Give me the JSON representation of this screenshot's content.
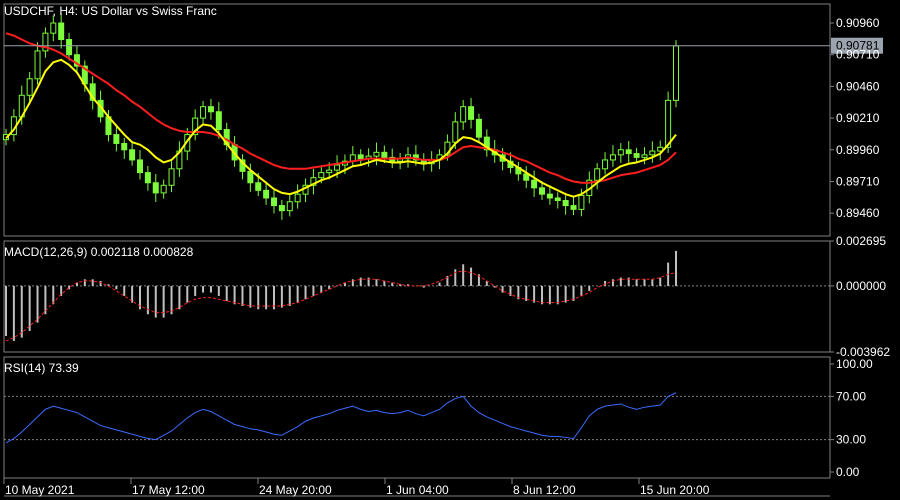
{
  "chart_data": [
    {
      "type": "candlestick",
      "title": "USDCHF, H4:  US Dollar vs Swiss Franc",
      "symbol": "USDCHF",
      "timeframe": "H4",
      "ylim": [
        0.8928,
        0.9111
      ],
      "y_ticks": [
        "0.90960",
        "0.90710",
        "0.90460",
        "0.90210",
        "0.89960",
        "0.89710",
        "0.89460"
      ],
      "current_price": "0.90781",
      "colors": {
        "bull": "#7CFC3A",
        "bear": "#7CFC3A",
        "ma_fast": "#FFFF00",
        "ma_slow": "#FF1E1E",
        "price_line": "#9BA3AE"
      },
      "closes": [
        0.9008,
        0.9022,
        0.9039,
        0.9052,
        0.9074,
        0.9088,
        0.9096,
        0.9083,
        0.9071,
        0.9062,
        0.9048,
        0.9035,
        0.9022,
        0.9008,
        0.9001,
        0.8996,
        0.8988,
        0.8978,
        0.897,
        0.8962,
        0.8968,
        0.8981,
        0.8995,
        0.9008,
        0.9021,
        0.903,
        0.9026,
        0.9012,
        0.9,
        0.8988,
        0.8979,
        0.897,
        0.8964,
        0.8958,
        0.8952,
        0.8948,
        0.8955,
        0.8961,
        0.8968,
        0.8974,
        0.8978,
        0.898,
        0.8984,
        0.8987,
        0.8992,
        0.8989,
        0.8991,
        0.8994,
        0.899,
        0.8987,
        0.8989,
        0.8992,
        0.8988,
        0.8985,
        0.8988,
        0.8992,
        0.9002,
        0.9018,
        0.903,
        0.902,
        0.9006,
        0.8996,
        0.8992,
        0.8987,
        0.8982,
        0.8977,
        0.8972,
        0.8966,
        0.8961,
        0.8958,
        0.8956,
        0.8952,
        0.8949,
        0.896,
        0.8972,
        0.8981,
        0.8988,
        0.8992,
        0.8996,
        0.8993,
        0.899,
        0.8992,
        0.8995,
        0.8998,
        0.9035,
        0.9078
      ],
      "ma_fast": [
        0.9005,
        0.9012,
        0.9022,
        0.9033,
        0.9045,
        0.9058,
        0.9065,
        0.9067,
        0.9063,
        0.9057,
        0.9047,
        0.9037,
        0.903,
        0.9022,
        0.9015,
        0.9008,
        0.9002,
        0.9,
        0.8996,
        0.899,
        0.8986,
        0.8988,
        0.8994,
        0.9003,
        0.9011,
        0.9016,
        0.9015,
        0.9009,
        0.9001,
        0.8993,
        0.8986,
        0.898,
        0.8975,
        0.897,
        0.8965,
        0.8962,
        0.8961,
        0.8963,
        0.8966,
        0.8969,
        0.8972,
        0.8974,
        0.8977,
        0.898,
        0.8983,
        0.8984,
        0.8986,
        0.8988,
        0.8987,
        0.8986,
        0.8986,
        0.8987,
        0.8986,
        0.8985,
        0.8986,
        0.8988,
        0.8993,
        0.9001,
        0.9006,
        0.9005,
        0.9002,
        0.8998,
        0.8994,
        0.899,
        0.8986,
        0.8982,
        0.8978,
        0.8974,
        0.897,
        0.8967,
        0.8964,
        0.8961,
        0.8959,
        0.8961,
        0.8965,
        0.897,
        0.8975,
        0.8979,
        0.8983,
        0.8985,
        0.8986,
        0.8988,
        0.899,
        0.8993,
        0.9,
        0.9008
      ],
      "ma_slow": [
        0.9088,
        0.9086,
        0.9083,
        0.908,
        0.9078,
        0.9077,
        0.9075,
        0.9072,
        0.9068,
        0.9064,
        0.906,
        0.9056,
        0.9052,
        0.9048,
        0.9043,
        0.9039,
        0.9034,
        0.903,
        0.9025,
        0.902,
        0.9016,
        0.9013,
        0.9011,
        0.901,
        0.901,
        0.901,
        0.9009,
        0.9007,
        0.9004,
        0.9,
        0.8997,
        0.8993,
        0.899,
        0.8987,
        0.8984,
        0.8982,
        0.8981,
        0.8981,
        0.8981,
        0.8982,
        0.8983,
        0.8984,
        0.8985,
        0.8986,
        0.8987,
        0.8988,
        0.8989,
        0.8989,
        0.8989,
        0.8989,
        0.8989,
        0.899,
        0.8989,
        0.8988,
        0.8988,
        0.8988,
        0.899,
        0.8994,
        0.8998,
        0.8999,
        0.8998,
        0.8997,
        0.8996,
        0.8994,
        0.8992,
        0.8989,
        0.8987,
        0.8984,
        0.8981,
        0.8978,
        0.8976,
        0.8973,
        0.8971,
        0.897,
        0.897,
        0.8971,
        0.8972,
        0.8974,
        0.8976,
        0.8977,
        0.8978,
        0.898,
        0.8982,
        0.8984,
        0.8988,
        0.8994
      ]
    },
    {
      "type": "bar",
      "title": "MACD(12,26,9) 0.002118 0.000828",
      "ylim": [
        -0.003962,
        0.002695
      ],
      "y_ticks": [
        "0.002695",
        "0.000000",
        "-0.003962"
      ],
      "colors": {
        "histogram": "#C0C0C0",
        "signal": "#FF2020",
        "zero_line": "#808080"
      },
      "histogram": [
        -0.003,
        -0.0033,
        -0.0031,
        -0.0027,
        -0.0022,
        -0.0017,
        -0.0011,
        -0.0006,
        -0.0002,
        0.0002,
        0.0004,
        0.0004,
        0.0003,
        0.0001,
        -0.0002,
        -0.0006,
        -0.001,
        -0.0014,
        -0.0017,
        -0.0019,
        -0.0019,
        -0.0017,
        -0.0014,
        -0.001,
        -0.0006,
        -0.0004,
        -0.0004,
        -0.0006,
        -0.0009,
        -0.0011,
        -0.0012,
        -0.0013,
        -0.0014,
        -0.0014,
        -0.0014,
        -0.0013,
        -0.0012,
        -0.001,
        -0.0008,
        -0.0006,
        -0.0004,
        -0.0002,
        0.0,
        0.0002,
        0.0004,
        0.0005,
        0.0005,
        0.0004,
        0.0003,
        0.0002,
        0.0001,
        0.0001,
        0.0,
        -0.0001,
        0.0,
        0.0002,
        0.0006,
        0.001,
        0.0013,
        0.0011,
        0.0007,
        0.0003,
        -0.0001,
        -0.0004,
        -0.0006,
        -0.0008,
        -0.0009,
        -0.001,
        -0.0011,
        -0.0011,
        -0.0011,
        -0.001,
        -0.0009,
        -0.0006,
        -0.0003,
        0.0,
        0.0003,
        0.0004,
        0.0005,
        0.0005,
        0.0004,
        0.0004,
        0.0004,
        0.0005,
        0.0014,
        0.0021
      ],
      "signal": [
        -0.0033,
        -0.0031,
        -0.0028,
        -0.0024,
        -0.002,
        -0.0015,
        -0.001,
        -0.0005,
        -0.0001,
        0.0002,
        0.0003,
        0.0003,
        0.0002,
        0.0,
        -0.0003,
        -0.0006,
        -0.0009,
        -0.0012,
        -0.0014,
        -0.0016,
        -0.0016,
        -0.0015,
        -0.0013,
        -0.001,
        -0.0008,
        -0.0007,
        -0.0007,
        -0.0008,
        -0.0009,
        -0.001,
        -0.0011,
        -0.0012,
        -0.0012,
        -0.0012,
        -0.0012,
        -0.0012,
        -0.0011,
        -0.001,
        -0.0008,
        -0.0006,
        -0.0004,
        -0.0002,
        0.0,
        0.0002,
        0.0003,
        0.0004,
        0.0004,
        0.0004,
        0.0003,
        0.0002,
        0.0001,
        0.0,
        0.0,
        0.0,
        0.0001,
        0.0003,
        0.0005,
        0.0008,
        0.0009,
        0.0008,
        0.0006,
        0.0003,
        0.0,
        -0.0003,
        -0.0005,
        -0.0007,
        -0.0008,
        -0.0009,
        -0.001,
        -0.001,
        -0.001,
        -0.0009,
        -0.0008,
        -0.0006,
        -0.0004,
        -0.0001,
        0.0001,
        0.0003,
        0.0004,
        0.0004,
        0.0004,
        0.0004,
        0.0004,
        0.0005,
        0.0007,
        0.0008
      ]
    },
    {
      "type": "line",
      "title": "RSI(14) 73.39",
      "ylim": [
        0,
        100
      ],
      "y_ticks": [
        "100.00",
        "70.00",
        "30.00",
        "0.00"
      ],
      "levels": [
        70,
        30
      ],
      "colors": {
        "line": "#3B6BFF",
        "level": "#808080"
      },
      "values": [
        27,
        31,
        37,
        44,
        51,
        58,
        61,
        59,
        57,
        55,
        51,
        47,
        43,
        41,
        39,
        37,
        35,
        33,
        31,
        30,
        34,
        38,
        44,
        50,
        55,
        58,
        56,
        52,
        48,
        44,
        42,
        40,
        39,
        37,
        35,
        34,
        38,
        42,
        47,
        50,
        52,
        54,
        57,
        59,
        61,
        58,
        56,
        57,
        55,
        54,
        55,
        57,
        54,
        52,
        55,
        58,
        64,
        68,
        70,
        61,
        55,
        51,
        48,
        45,
        42,
        40,
        38,
        36,
        34,
        33,
        33,
        32,
        31,
        41,
        52,
        58,
        61,
        62,
        63,
        60,
        58,
        60,
        61,
        62,
        70,
        73.39
      ]
    }
  ],
  "x_axis": {
    "labels": [
      "10 May 2021",
      "17 May 12:00",
      "24 May 20:00",
      "1 Jun 04:00",
      "8 Jun 12:00",
      "15 Jun 20:00"
    ]
  }
}
